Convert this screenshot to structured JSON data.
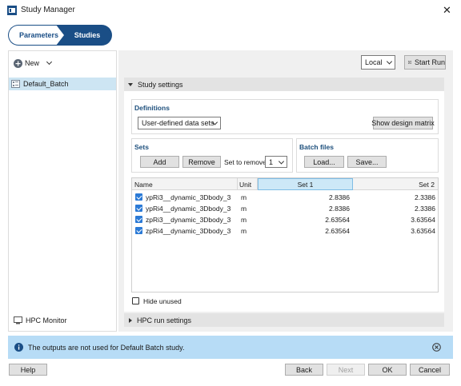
{
  "window": {
    "title": "Study Manager",
    "close_glyph": "✕"
  },
  "breadcrumb": {
    "step1": "Parameters",
    "step2": "Studies"
  },
  "sidebar": {
    "new_label": "New",
    "items": [
      {
        "label": "Default_Batch",
        "selected": true
      }
    ],
    "hpc_monitor_label": "HPC Monitor"
  },
  "toolbar": {
    "location": "Local",
    "start_run_label": "Start Run"
  },
  "study_settings": {
    "header": "Study settings",
    "definitions": {
      "title": "Definitions",
      "mode": "User-defined data sets",
      "show_design_matrix_label": "Show design matrix"
    },
    "sets": {
      "title": "Sets",
      "add_label": "Add",
      "remove_label": "Remove",
      "set_to_remove_label": "Set to remove",
      "set_to_remove_value": "1"
    },
    "batch_files": {
      "title": "Batch files",
      "load_label": "Load...",
      "save_label": "Save..."
    },
    "table": {
      "headers": [
        "Name",
        "Unit",
        "Set 1",
        "Set 2"
      ],
      "rows": [
        {
          "checked": true,
          "name": "ypRi3__dynamic_3Dbody_3",
          "unit": "m",
          "set1": "2.8386",
          "set2": "2.3386"
        },
        {
          "checked": true,
          "name": "ypRi4__dynamic_3Dbody_3",
          "unit": "m",
          "set1": "2.8386",
          "set2": "2.3386"
        },
        {
          "checked": true,
          "name": "zpRi3__dynamic_3Dbody_3",
          "unit": "m",
          "set1": "2.63564",
          "set2": "3.63564"
        },
        {
          "checked": true,
          "name": "zpRi4__dynamic_3Dbody_3",
          "unit": "m",
          "set1": "2.63564",
          "set2": "3.63564"
        }
      ]
    },
    "hide_unused_label": "Hide unused",
    "hide_unused_checked": false
  },
  "hpc_run_settings": {
    "header": "HPC run settings"
  },
  "info_bar": {
    "message": "The outputs are not used for Default Batch study."
  },
  "footer": {
    "help_label": "Help",
    "back_label": "Back",
    "next_label": "Next",
    "ok_label": "OK",
    "cancel_label": "Cancel"
  },
  "colors": {
    "accent": "#1a4e86",
    "selection": "#cde5f3",
    "info_bg": "#b7dcf6",
    "checkbox": "#2b7ad6"
  }
}
